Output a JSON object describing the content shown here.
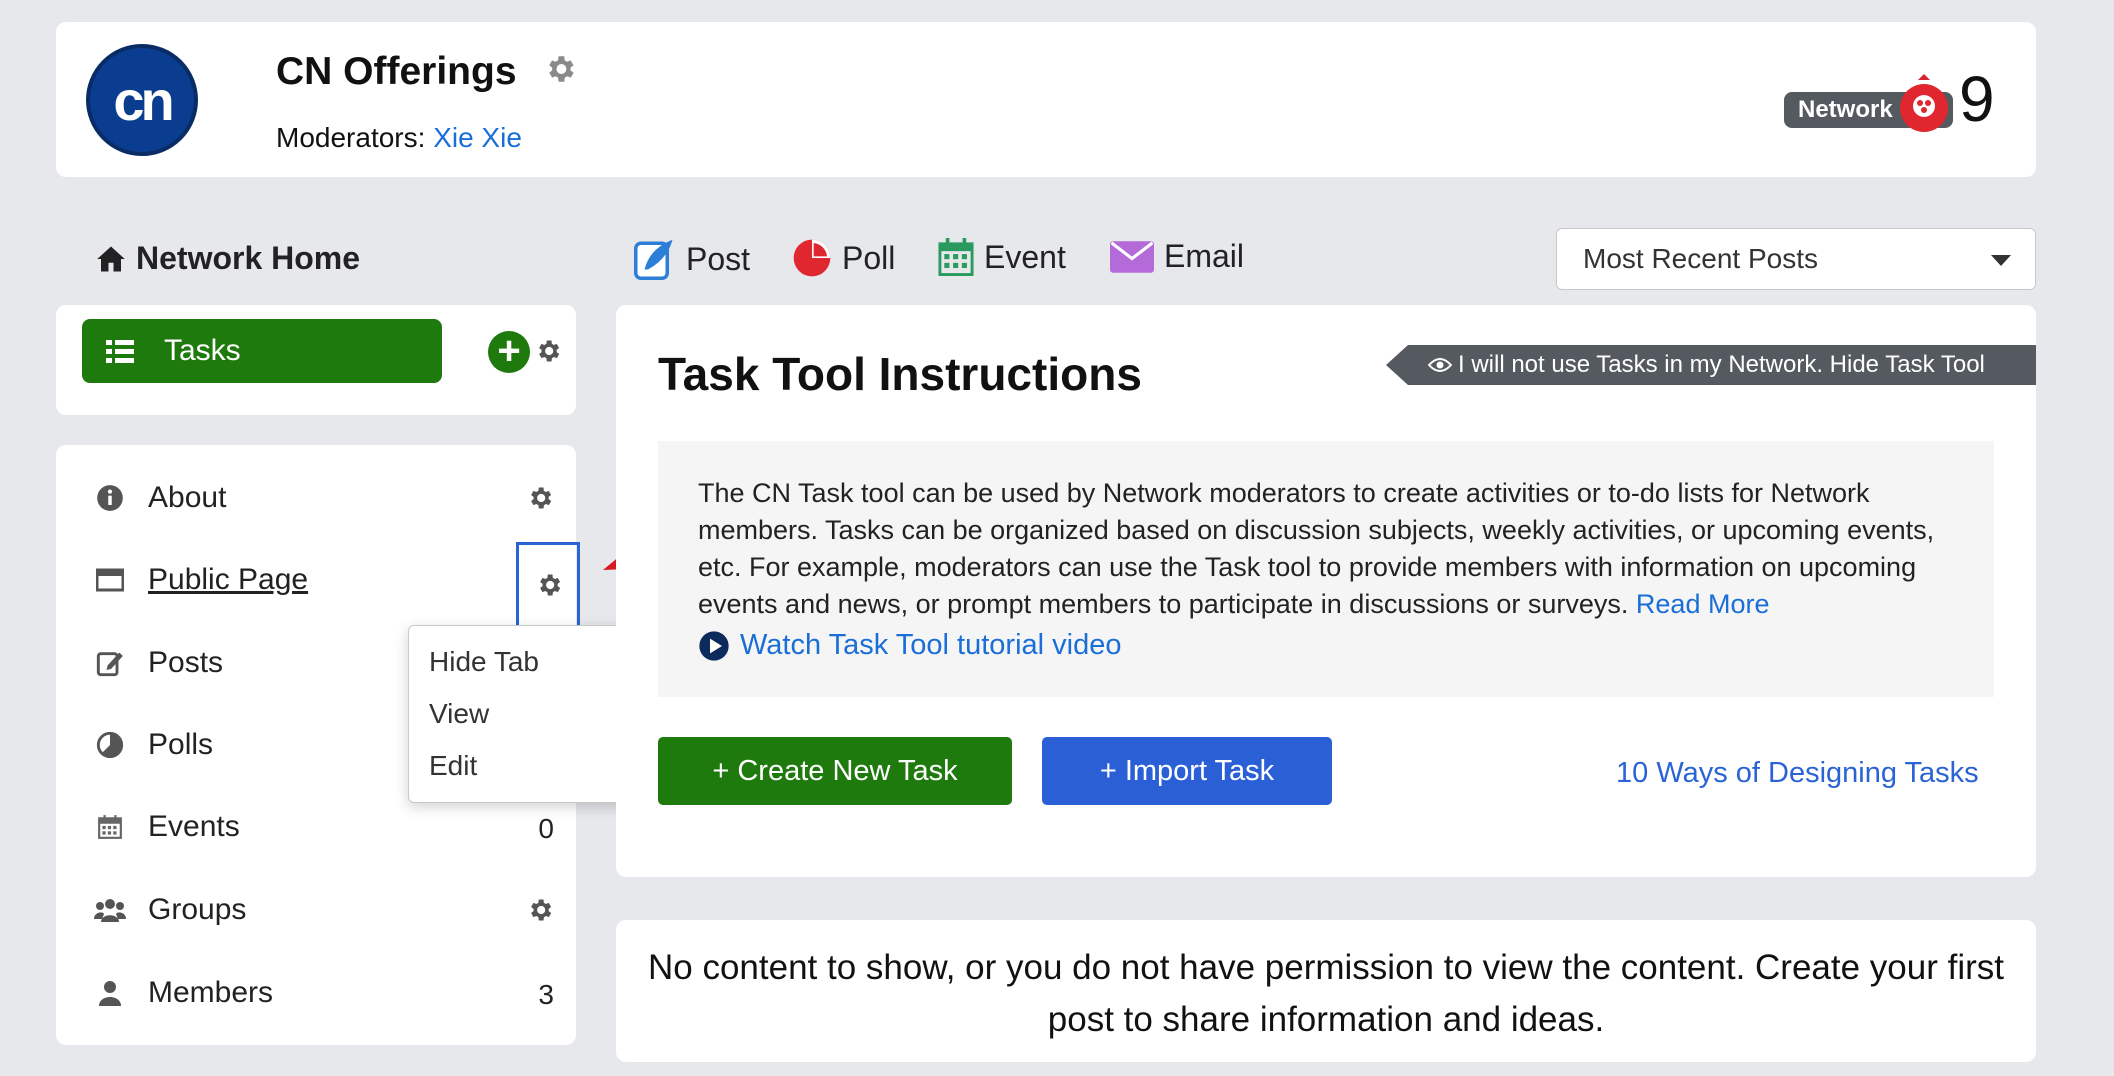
{
  "header": {
    "logo_text": "cn",
    "network_name": "CN Offerings",
    "moderators_label": "Moderators:",
    "moderators_link": "Xie Xie",
    "badge_label": "Network",
    "count": "9"
  },
  "sidebar": {
    "home_label": "Network Home",
    "tasks_label": "Tasks",
    "items": [
      {
        "label": "About",
        "right": ""
      },
      {
        "label": "Public Page",
        "right": ""
      },
      {
        "label": "Posts",
        "right": ""
      },
      {
        "label": "Polls",
        "right": ""
      },
      {
        "label": "Events",
        "right": "0"
      },
      {
        "label": "Groups",
        "right": ""
      },
      {
        "label": "Members",
        "right": "3"
      }
    ]
  },
  "context_menu": {
    "items": [
      "Hide Tab",
      "View",
      "Edit"
    ]
  },
  "composer": {
    "post": "Post",
    "poll": "Poll",
    "event": "Event",
    "email": "Email",
    "sort_selected": "Most Recent Posts"
  },
  "instructions": {
    "title": "Task Tool Instructions",
    "hide_tool": "I will not use Tasks in my Network. Hide Task Tool",
    "body": "The CN Task tool can be used by Network moderators to create activities or to-do lists for Network members. Tasks can be organized based on discussion subjects, weekly activities, or upcoming events, etc. For example, moderators can use the Task tool to provide members with information on upcoming events and news, or prompt members to participate in discussions or surveys.",
    "read_more": "Read More",
    "video_link": "Watch Task Tool tutorial video",
    "create_btn": "+ Create New Task",
    "import_btn": "+ Import Task",
    "ways_link": "10 Ways of Designing Tasks"
  },
  "empty_state": {
    "text": "No content to show, or you do not have permission to view the content. Create your first post to share information and ideas."
  },
  "colors": {
    "green": "#1f7a0e",
    "blue": "#2a5fd6",
    "link": "#1a6ed8",
    "badge": "#555a60"
  }
}
